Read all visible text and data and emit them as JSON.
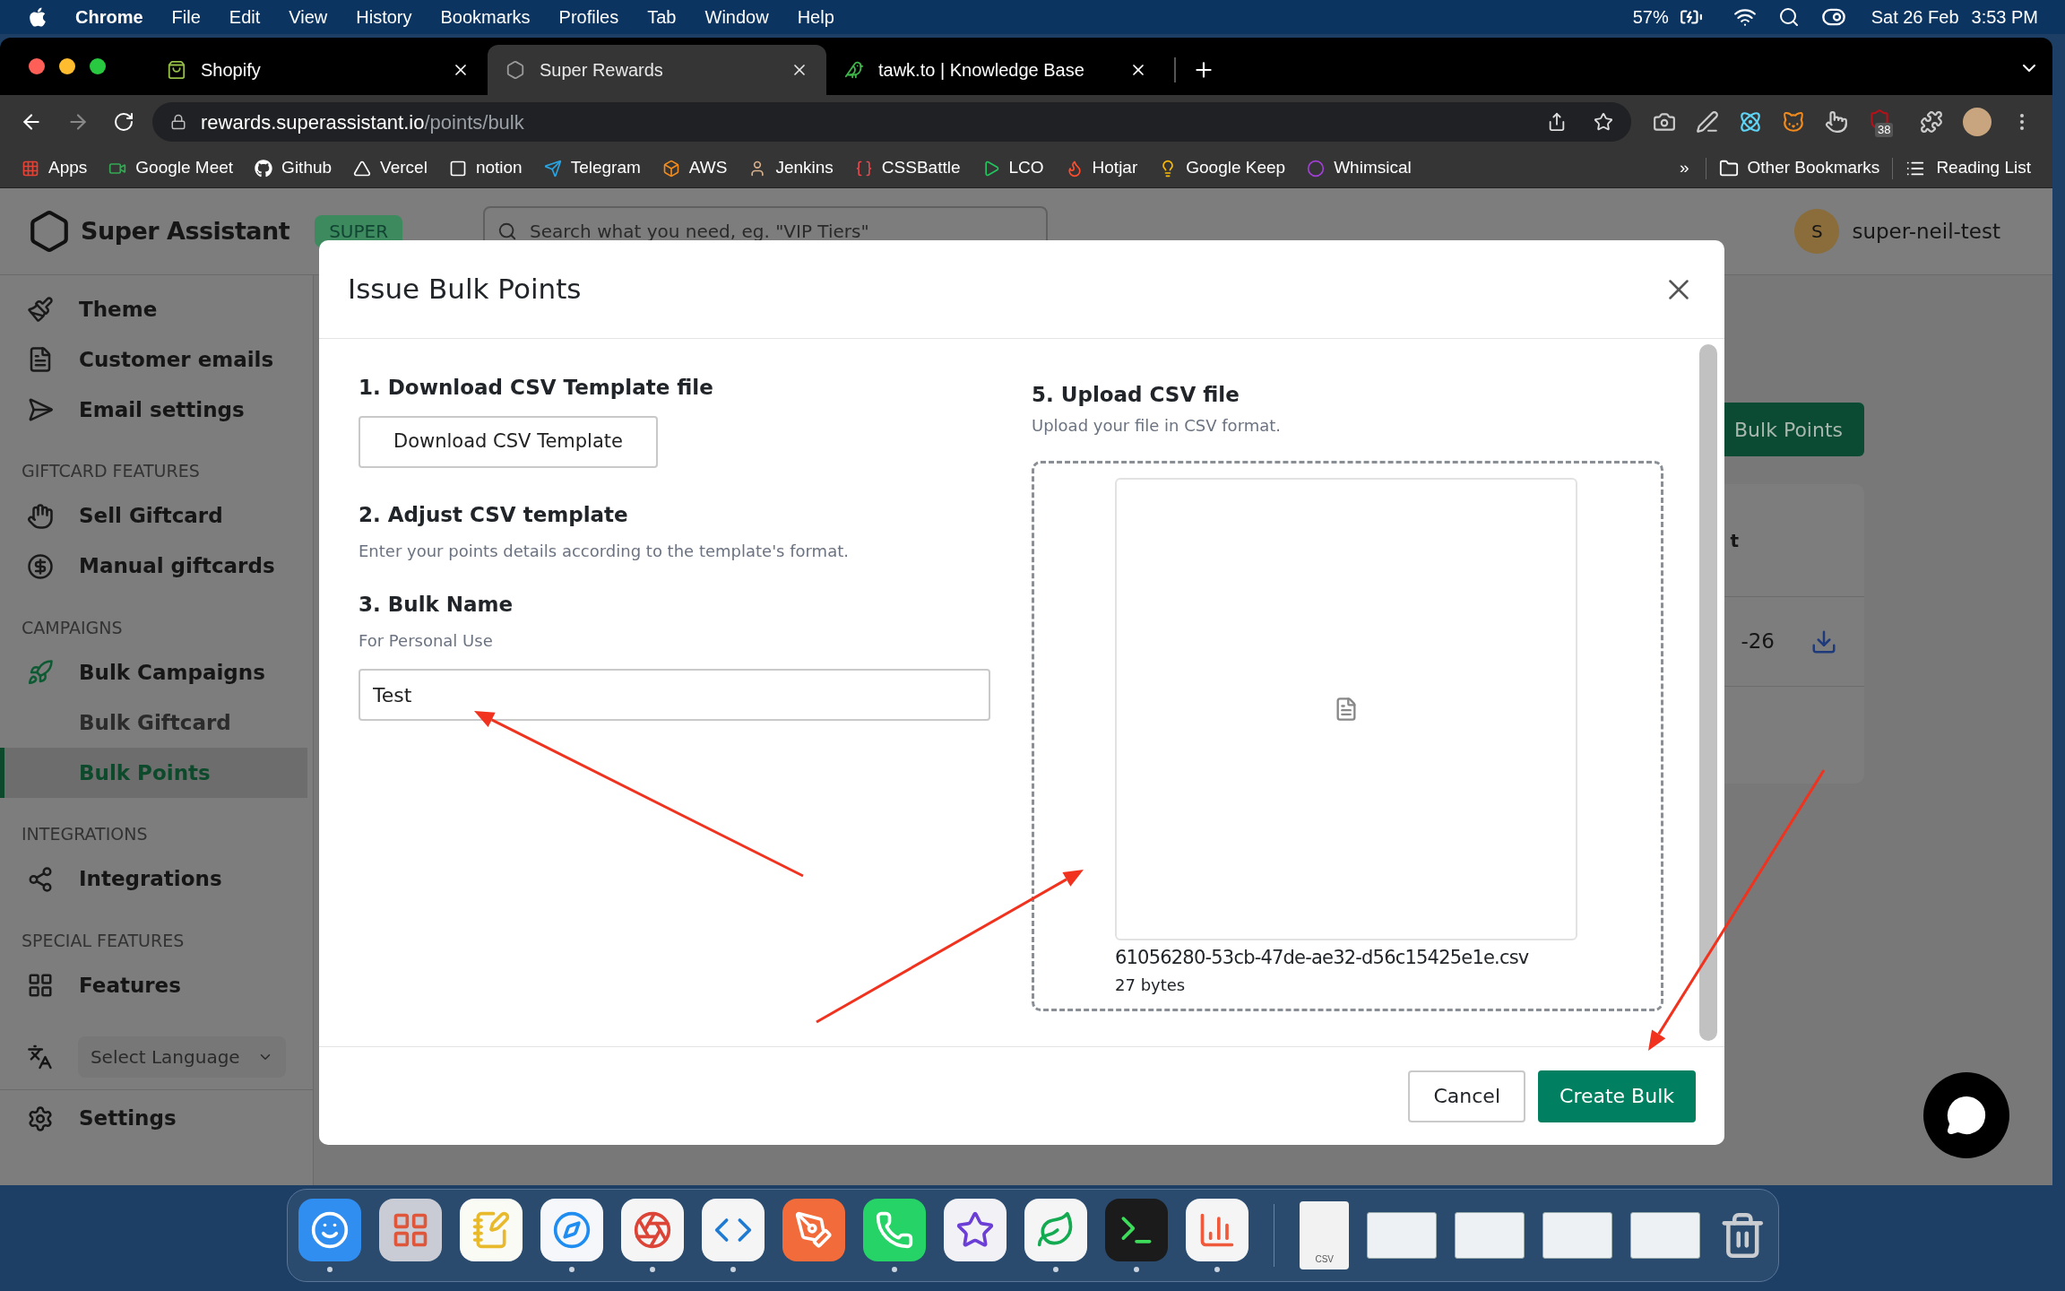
{
  "menubar": {
    "app": "Chrome",
    "items": [
      "File",
      "Edit",
      "View",
      "History",
      "Bookmarks",
      "Profiles",
      "Tab",
      "Window",
      "Help"
    ],
    "battery": "57%",
    "date": "Sat 26 Feb",
    "time": "3:53 PM"
  },
  "tabs": [
    {
      "title": "Shopify",
      "selected": false
    },
    {
      "title": "Super Rewards",
      "selected": true
    },
    {
      "title": "tawk.to | Knowledge Base",
      "selected": false
    }
  ],
  "address": {
    "host": "rewards.superassistant.io",
    "path": "/points/bulk"
  },
  "extension_badge": "38",
  "bookmarks": [
    {
      "label": "Apps"
    },
    {
      "label": "Google Meet"
    },
    {
      "label": "Github"
    },
    {
      "label": "Vercel"
    },
    {
      "label": "notion"
    },
    {
      "label": "Telegram"
    },
    {
      "label": "AWS"
    },
    {
      "label": "Jenkins"
    },
    {
      "label": "CSSBattle"
    },
    {
      "label": "LCO"
    },
    {
      "label": "Hotjar"
    },
    {
      "label": "Google Keep"
    },
    {
      "label": "Whimsical"
    }
  ],
  "bookmarks_overflow": "»",
  "other_bookmarks": "Other Bookmarks",
  "reading_list": "Reading List",
  "app": {
    "brand": "Super Assistant",
    "plan": "SUPER",
    "search_placeholder": "Search what you need, eg. \"VIP Tiers\"",
    "user_initial": "S",
    "user_name": "super-neil-test"
  },
  "sidebar": {
    "sections": [
      {
        "items": [
          {
            "label": "Theme",
            "selected": false
          },
          {
            "label": "Customer emails",
            "selected": false
          },
          {
            "label": "Email settings",
            "selected": false
          }
        ]
      },
      {
        "heading": "GIFTCARD FEATURES",
        "items": [
          {
            "label": "Sell Giftcard",
            "selected": false
          },
          {
            "label": "Manual giftcards",
            "selected": false
          }
        ]
      },
      {
        "heading": "CAMPAIGNS",
        "items": [
          {
            "label": "Bulk Campaigns",
            "selected": false,
            "expanded": true,
            "children": [
              {
                "label": "Bulk Giftcard",
                "selected": false
              },
              {
                "label": "Bulk Points",
                "selected": true
              }
            ]
          }
        ]
      },
      {
        "heading": "INTEGRATIONS",
        "items": [
          {
            "label": "Integrations",
            "selected": false
          }
        ]
      },
      {
        "heading": "SPECIAL FEATURES",
        "items": [
          {
            "label": "Features",
            "selected": false
          }
        ]
      }
    ],
    "language": "Select Language",
    "settings": "Settings"
  },
  "main": {
    "action_button": "Bulk Points",
    "column_header": "t",
    "cell": "-26"
  },
  "modal": {
    "title": "Issue Bulk Points",
    "steps": [
      {
        "kind": "button",
        "title": "1. Download CSV Template file",
        "button": "Download CSV Template"
      },
      {
        "kind": "text",
        "title": "2. Adjust CSV template",
        "hint": "Enter your points details according to the template's format."
      },
      {
        "kind": "input",
        "title": "3. Bulk Name",
        "hint": "For Personal Use",
        "value": "Test"
      }
    ],
    "upload": {
      "title": "5. Upload CSV file",
      "hint": "Upload your file in CSV format.",
      "file_name": "61056280-53cb-47de-ae32-d56c15425e1e.csv",
      "file_size": "27 bytes"
    },
    "cancel": "Cancel",
    "submit": "Create Bulk"
  },
  "dock": {
    "items": [
      {
        "running": true
      },
      {
        "running": false
      },
      {
        "running": false
      },
      {
        "running": true
      },
      {
        "running": true
      },
      {
        "running": true
      },
      {
        "running": false
      },
      {
        "running": true
      },
      {
        "running": false
      },
      {
        "running": true
      },
      {
        "running": true
      },
      {
        "running": true
      }
    ],
    "file_label": "CSV",
    "windows": [
      {
        "kind": "window"
      },
      {
        "kind": "window"
      },
      {
        "kind": "window"
      },
      {
        "kind": "window"
      }
    ]
  }
}
